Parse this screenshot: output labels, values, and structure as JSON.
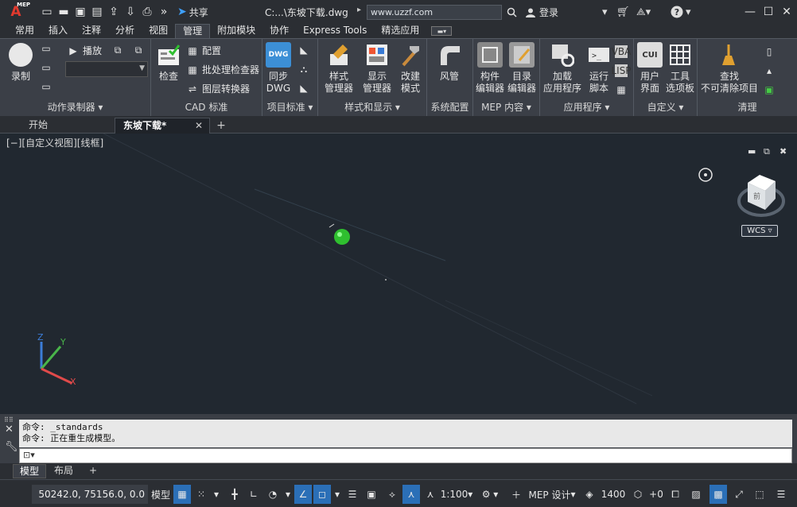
{
  "titlebar": {
    "logo": "A",
    "logo_sub": "MEP",
    "share_label": "共享",
    "file_title": "C:...\\东坡下载.dwg",
    "path_more": "▸",
    "search_value": "www.uzzf.com",
    "login_label": "登录",
    "qat_icons": [
      "new-icon",
      "open-icon",
      "save-icon",
      "saveas-icon",
      "upload-icon",
      "download-icon",
      "print-icon",
      "more-icon"
    ]
  },
  "ribbon_tabs": [
    "常用",
    "插入",
    "注释",
    "分析",
    "视图",
    "管理",
    "附加模块",
    "协作",
    "Express Tools",
    "精选应用"
  ],
  "active_tab": "管理",
  "ribbon": {
    "record_label": "录制",
    "play_label": "播放",
    "panel_action": "动作录制器",
    "check_label": "检查",
    "config_label": "配置",
    "batch_label": "批处理检查器",
    "layer_conv_label": "图层转换器",
    "panel_cad": "CAD 标准",
    "sync_label1": "同步",
    "sync_label2": "DWG",
    "panel_project": "项目标准",
    "style_mgr_label1": "样式",
    "style_mgr_label2": "管理器",
    "display_mgr_label1": "显示",
    "display_mgr_label2": "管理器",
    "modify_label1": "改建",
    "modify_label2": "模式",
    "panel_style": "样式和显示",
    "duct_label": "风管",
    "panel_sys": "系统配置",
    "part_label1": "构件",
    "part_label2": "编辑器",
    "catalog_label1": "目录",
    "catalog_label2": "编辑器",
    "panel_mep": "MEP 内容",
    "load_label1": "加载",
    "load_label2": "应用程序",
    "run_label1": "运行",
    "run_label2": "脚本",
    "panel_app": "应用程序",
    "user_label1": "用户",
    "user_label2": "界面",
    "tool_label1": "工具",
    "tool_label2": "选项板",
    "panel_custom": "自定义",
    "find_label1": "查找",
    "find_label2": "不可清除项目",
    "panel_clean": "清理",
    "cui_text": "CUI",
    "dwg_badge": "DWG",
    "vba_badge": "VBA",
    "lisp_badge": "LISP"
  },
  "doc_tabs": {
    "start": "开始",
    "file": "东坡下载*",
    "close": "✕",
    "add": "+"
  },
  "canvas": {
    "view_label": "[−][自定义视图][线框]",
    "wcs_label": "WCS",
    "viewcube_face": "前",
    "ucs_x": "X",
    "ucs_y": "Y",
    "ucs_z": "Z"
  },
  "command": {
    "line1": "命令:  _standards",
    "line2": "命令:  正在重生成模型。"
  },
  "layout_tabs": [
    "模型",
    "布局"
  ],
  "layout_add": "+",
  "status": {
    "coords": "50242.0, 75156.0, 0.0",
    "model": "模型",
    "scale": "1:100",
    "mep": "MEP 设计",
    "elevation": "1400",
    "plus0": "+0"
  },
  "colors": {
    "accent": "#2b6fb7",
    "canvas_bg": "#212830",
    "point_green": "#2fbf2f"
  }
}
